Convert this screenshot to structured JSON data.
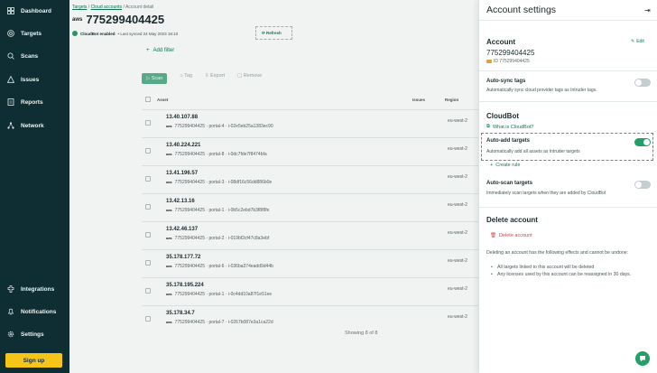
{
  "sidebar": {
    "items": [
      {
        "label": "Dashboard",
        "icon": "dashboard-icon"
      },
      {
        "label": "Targets",
        "icon": "targets-icon"
      },
      {
        "label": "Scans",
        "icon": "scans-icon"
      },
      {
        "label": "Issues",
        "icon": "issues-icon"
      },
      {
        "label": "Reports",
        "icon": "reports-icon"
      },
      {
        "label": "Network",
        "icon": "network-icon"
      }
    ],
    "bottom": [
      {
        "label": "Integrations",
        "icon": "integrations-icon"
      },
      {
        "label": "Notifications",
        "icon": "bell-icon"
      },
      {
        "label": "Settings",
        "icon": "gear-icon"
      }
    ],
    "signup_label": "Sign up"
  },
  "breadcrumb": {
    "items": [
      "Targets",
      "Cloud accounts",
      "Account detail"
    ],
    "sep": "/"
  },
  "account": {
    "provider": "aws",
    "id": "775299404425",
    "status": "CloudBot enabled",
    "last_synced": "• Last synced 24 May 2023 18:10",
    "refresh_label": "Refresh"
  },
  "filters": {
    "add_label": "Add filter"
  },
  "toolbar": [
    "Scan",
    "Tag",
    "Export",
    "Remove"
  ],
  "table": {
    "headers": {
      "asset": "Asset",
      "issues": "Issues",
      "region": "Region"
    },
    "rows": [
      {
        "ip": "13.40.107.88",
        "sub": "775299404425 · portal-4 · i-02e5eb25a1383ec90",
        "region": "eu-west-2"
      },
      {
        "ip": "13.40.224.221",
        "sub": "775299404425 · portal-8 · i-0dc7fde7f8474bfa",
        "region": "eu-west-2"
      },
      {
        "ip": "13.41.196.57",
        "sub": "775299404425 · portal-3 · i-08df16c56dd886b0e",
        "region": "eu-west-2"
      },
      {
        "ip": "13.42.13.16",
        "sub": "775299404425 · portal-1 · i-0b5c2ebd7b3f8f8fe",
        "region": "eu-west-2"
      },
      {
        "ip": "13.42.46.137",
        "sub": "775299404425 · portal-2 · i-019bf2cf47c8a3ebf",
        "region": "eu-west-2"
      },
      {
        "ip": "35.178.177.72",
        "sub": "775299404425 · portal-6 · i-036ba374eadd9d44b",
        "region": "eu-west-2"
      },
      {
        "ip": "35.178.195.224",
        "sub": "775299404425 · portal-1 · i-0c4dd10a87f1e51ee",
        "region": "eu-west-2"
      },
      {
        "ip": "35.178.34.7",
        "sub": "775299404425 · portal-7 · i-0267b087e3a1ca22d",
        "region": "eu-west-2"
      }
    ],
    "footer": "Showing 8 of 8"
  },
  "panel": {
    "title": "Account settings",
    "account_heading": "Account",
    "edit_label": "Edit",
    "account_name": "775299404425",
    "account_id": "ID 775299404425",
    "auto_sync": {
      "label": "Auto-sync tags",
      "desc": "Automatically sync cloud provider tags as Intruder tags.",
      "on": false
    },
    "cloudbot_heading": "CloudBot",
    "what_is_label": "What is CloudBot?",
    "auto_add": {
      "label": "Auto-add targets",
      "desc": "Automatically add all assets as Intruder targets",
      "on": true
    },
    "create_rule_label": "Create rule",
    "auto_scan": {
      "label": "Auto-scan targets",
      "desc": "Immediately scan targets when they are added by CloudBot",
      "on": false
    },
    "delete_heading": "Delete account",
    "delete_label": "Delete account",
    "delete_text": "Deleting an account has the following effects and cannot be undone:",
    "delete_effects": [
      "All targets linked to this account will be deleted",
      "Any licenses used by this account can be reassigned in 30 days."
    ]
  },
  "colors": {
    "sidebar_bg": "#0f2e33",
    "accent": "#23a06a",
    "signup": "#f5c518",
    "danger": "#d54545"
  }
}
